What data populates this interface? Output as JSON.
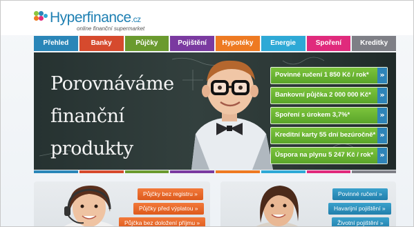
{
  "brand": {
    "name": "Hyperfinance",
    "tld": ".cz",
    "tagline": "online finanční supermarket"
  },
  "nav": {
    "tabs": [
      {
        "label": "Přehled",
        "color": "#2a86b8"
      },
      {
        "label": "Banky",
        "color": "#d64a2d"
      },
      {
        "label": "Půjčky",
        "color": "#6a9a2e"
      },
      {
        "label": "Pojištění",
        "color": "#7a3aa0"
      },
      {
        "label": "Hypotéky",
        "color": "#ee7a22"
      },
      {
        "label": "Energie",
        "color": "#2ea9d6"
      },
      {
        "label": "Spoření",
        "color": "#e02a7c"
      },
      {
        "label": "Kreditky",
        "color": "#7e7f86"
      }
    ]
  },
  "hero": {
    "title_lines": [
      "Porovnáváme",
      "finanční",
      "produkty"
    ],
    "offers": [
      {
        "label": "Povinné ručení 1 850 Kč / rok*",
        "arrow": "»"
      },
      {
        "label": "Bankovní půjčka 2 000 000 Kč*",
        "arrow": "»"
      },
      {
        "label": "Spoření s úrokem 3,7%*",
        "arrow": "»"
      },
      {
        "label": "Kreditní karty 55 dní bezúročně*",
        "arrow": "»"
      },
      {
        "label": "Úspora na plynu 5 247 Kč / rok*",
        "arrow": "»"
      }
    ]
  },
  "panels": {
    "loans": {
      "links": [
        "Půjčky bez registru »",
        "Půjčky před výplatou »",
        "Půjčka bez doložení příjmu »"
      ]
    },
    "insurance": {
      "links": [
        "Povinné ručení »",
        "Havarijní pojištění »",
        "Životní pojištění »"
      ]
    }
  }
}
